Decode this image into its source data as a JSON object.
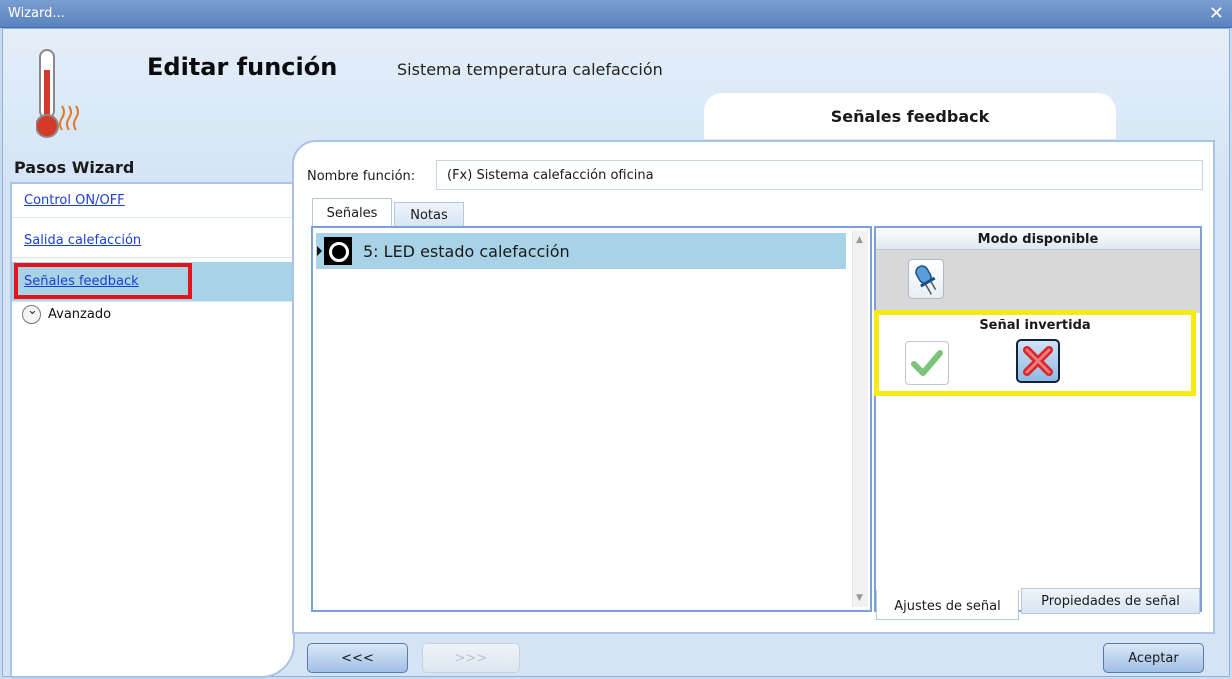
{
  "window": {
    "title": "Wizard...",
    "close_glyph": "✕"
  },
  "header": {
    "title": "Editar función",
    "subtitle": "Sistema temperatura calefacción",
    "tab": "Señales feedback"
  },
  "sidebar": {
    "title": "Pasos Wizard",
    "items": [
      {
        "label": "Control ON/OFF"
      },
      {
        "label": "Salida calefacción"
      },
      {
        "label": "Señales feedback"
      }
    ],
    "advanced_label": "Avanzado"
  },
  "function": {
    "label": "Nombre función:",
    "value": "(Fx) Sistema calefacción oficina"
  },
  "tabs": {
    "signals": "Señales",
    "notes": "Notas"
  },
  "signals_list": [
    {
      "label": "5: LED estado calefacción",
      "icon": "led-status-icon"
    }
  ],
  "right_panel": {
    "available_mode_title": "Modo disponible",
    "inverted_signal_title": "Señal invertida",
    "tab_settings": "Ajustes de señal",
    "tab_properties": "Propiedades de señal"
  },
  "buttons": {
    "back": "<<<",
    "next": ">>>",
    "accept": "Aceptar"
  },
  "colors": {
    "highlight_red": "#e2151d",
    "highlight_yellow": "#f5ea13",
    "selected_row": "#a8d2e6",
    "titlebar": "#5b82bf"
  }
}
